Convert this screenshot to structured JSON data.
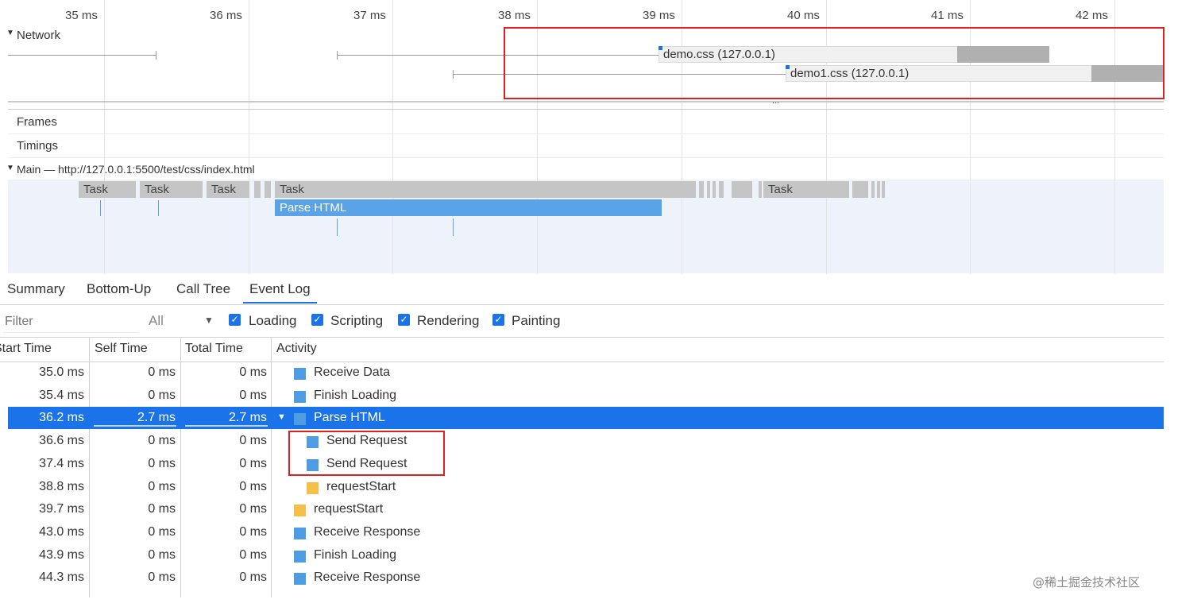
{
  "timeline": {
    "ticks": [
      "35 ms",
      "36 ms",
      "37 ms",
      "38 ms",
      "39 ms",
      "40 ms",
      "41 ms",
      "42 ms"
    ],
    "network_label": "Network",
    "requests": [
      "demo.css (127.0.0.1)",
      "demo1.css (127.0.0.1)"
    ],
    "divider_dots": "...",
    "frames_label": "Frames",
    "timings_label": "Timings",
    "main_label": "Main — http://127.0.0.1:5500/test/css/index.html",
    "tasks": [
      "Task",
      "Task",
      "Task",
      "Task",
      "Task"
    ],
    "parse_html": "Parse HTML"
  },
  "tabs": [
    "Summary",
    "Bottom-Up",
    "Call Tree",
    "Event Log"
  ],
  "filter": {
    "placeholder": "Filter",
    "select_value": "All",
    "checkboxes": [
      "Loading",
      "Scripting",
      "Rendering",
      "Painting"
    ]
  },
  "table": {
    "headers": [
      "Start Time",
      "Self Time",
      "Total Time",
      "Activity"
    ],
    "rows": [
      {
        "start": "35.0 ms",
        "self": "0 ms",
        "total": "0 ms",
        "activity": "Receive Data"
      },
      {
        "start": "35.4 ms",
        "self": "0 ms",
        "total": "0 ms",
        "activity": "Finish Loading"
      },
      {
        "start": "36.2 ms",
        "self": "2.7 ms",
        "total": "2.7 ms",
        "activity": "Parse HTML"
      },
      {
        "start": "36.6 ms",
        "self": "0 ms",
        "total": "0 ms",
        "activity": "Send Request"
      },
      {
        "start": "37.4 ms",
        "self": "0 ms",
        "total": "0 ms",
        "activity": "Send Request"
      },
      {
        "start": "38.8 ms",
        "self": "0 ms",
        "total": "0 ms",
        "activity": "requestStart"
      },
      {
        "start": "39.7 ms",
        "self": "0 ms",
        "total": "0 ms",
        "activity": "requestStart"
      },
      {
        "start": "43.0 ms",
        "self": "0 ms",
        "total": "0 ms",
        "activity": "Receive Response"
      },
      {
        "start": "43.9 ms",
        "self": "0 ms",
        "total": "0 ms",
        "activity": "Finish Loading"
      },
      {
        "start": "44.3 ms",
        "self": "0 ms",
        "total": "0 ms",
        "activity": "Receive Response"
      }
    ]
  },
  "watermark": "@稀土掘金技术社区",
  "colors": {
    "loading": "#4e9de3",
    "scripting": "#f5c04a",
    "selected_row": "#1a73e8",
    "highlight_box": "#e02020",
    "parse_html": "#5aa3e6"
  }
}
